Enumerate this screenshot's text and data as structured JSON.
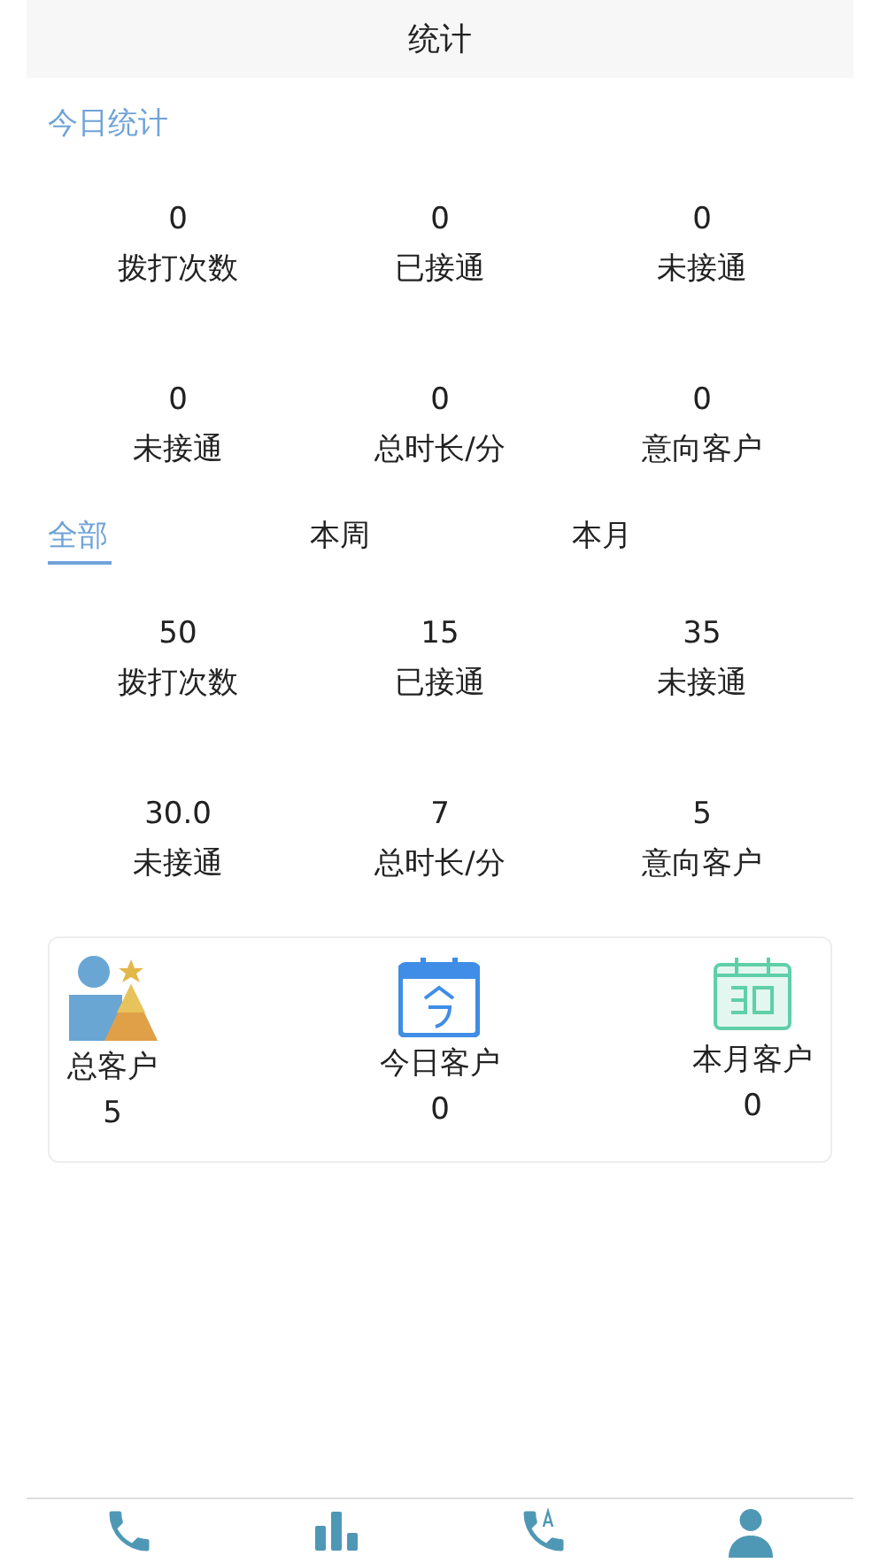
{
  "header": {
    "title": "统计"
  },
  "today": {
    "title": "今日统计",
    "stats": [
      {
        "value": "0",
        "label": "拨打次数"
      },
      {
        "value": "0",
        "label": "已接通"
      },
      {
        "value": "0",
        "label": "未接通"
      },
      {
        "value": "0",
        "label": "未接通"
      },
      {
        "value": "0",
        "label": "总时长/分"
      },
      {
        "value": "0",
        "label": "意向客户"
      }
    ]
  },
  "period_tabs": [
    {
      "label": "全部",
      "selected": true
    },
    {
      "label": "本周",
      "selected": false
    },
    {
      "label": "本月",
      "selected": false
    }
  ],
  "period_stats": [
    {
      "value": "50",
      "label": "拨打次数"
    },
    {
      "value": "15",
      "label": "已接通"
    },
    {
      "value": "35",
      "label": "未接通"
    },
    {
      "value": "30.0",
      "label": "未接通"
    },
    {
      "value": "7",
      "label": "总时长/分"
    },
    {
      "value": "5",
      "label": "意向客户"
    }
  ],
  "customers": [
    {
      "kind": "total",
      "label": "总客户",
      "value": "5"
    },
    {
      "kind": "today",
      "label": "今日客户",
      "value": "0"
    },
    {
      "kind": "month",
      "label": "本月客户",
      "value": "0"
    }
  ],
  "bottom_nav": [
    {
      "kind": "phone"
    },
    {
      "kind": "chart"
    },
    {
      "kind": "auto-dial"
    },
    {
      "kind": "person"
    }
  ]
}
